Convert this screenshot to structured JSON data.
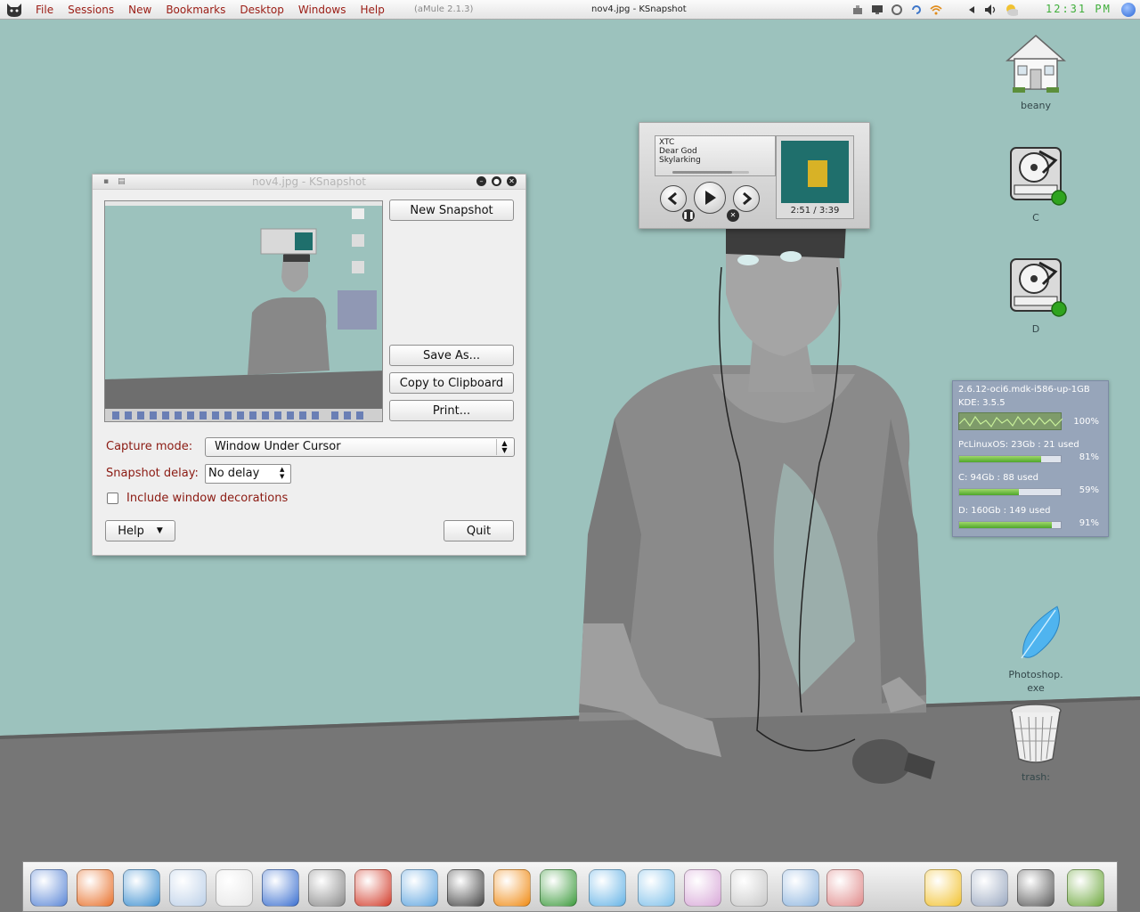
{
  "menubar": {
    "items": [
      "File",
      "Sessions",
      "New",
      "Bookmarks",
      "Desktop",
      "Windows",
      "Help"
    ],
    "app_title": "(aMule 2.1.3)",
    "window_title": "nov4.jpg - KSnapshot",
    "tray_icons": [
      "network-icon",
      "monitor-icon",
      "power-icon",
      "refresh-icon",
      "wifi-icon",
      "left-arrow-icon",
      "volume-icon",
      "weather-icon"
    ],
    "clock": "12:31 PM"
  },
  "desktop_icons": [
    {
      "label": "beany",
      "icon": "home-icon"
    },
    {
      "label": "C",
      "icon": "harddisk-icon"
    },
    {
      "label": "D",
      "icon": "harddisk-icon"
    },
    {
      "label": "Photoshop.\nexe",
      "icon": "feather-icon"
    },
    {
      "label": "trash:",
      "icon": "trash-icon"
    }
  ],
  "ksnapshot": {
    "title": "nov4.jpg - KSnapshot",
    "new_snapshot": "New Snapshot",
    "save_as": "Save As...",
    "copy_clipboard": "Copy to Clipboard",
    "print": "Print...",
    "capture_mode_label": "Capture mode:",
    "capture_mode_value": "Window Under Cursor",
    "snapshot_delay_label": "Snapshot delay:",
    "snapshot_delay_value": "No delay",
    "include_decorations_label": "Include window decorations",
    "include_decorations_checked": false,
    "help": "Help",
    "quit": "Quit"
  },
  "player": {
    "artist": "XTC",
    "track": "Dear God",
    "album": "Skylarking",
    "time": "2:51 / 3:39",
    "progress": 0.78
  },
  "sysmon": {
    "kernel": "2.6.12-oci6.mdk-i586-up-1GB",
    "kde": "KDE: 3.5.5",
    "cpu_pct": "100%",
    "cpu_value": 1.0,
    "disks": [
      {
        "label": "PcLinuxOS: 23Gb : 21 used",
        "pct": "81%",
        "value": 0.81
      },
      {
        "label": "C: 94Gb : 88 used",
        "pct": "59%",
        "value": 0.59
      },
      {
        "label": "D: 160Gb : 149 used",
        "pct": "91%",
        "value": 0.91
      }
    ]
  },
  "colors": {
    "menu_text": "#9b1c14",
    "clock": "#3fae3a",
    "wallpaper": "#9cc2bd",
    "bar_fill": "#4ea62a"
  },
  "dock": {
    "icons": [
      "finder-icon",
      "firefox-icon",
      "network-globe-icon",
      "rabbit-icon",
      "mail-icon",
      "notes-icon",
      "gimp-icon",
      "burner-icon",
      "dashboard-icon",
      "clapper-icon",
      "vlc-icon",
      "video-icon",
      "itunes-icon",
      "music-player-icon",
      "ipod-icon",
      "phone-icon",
      "scanner-icon",
      "camera-icon",
      "tux-icon",
      "settings-icon",
      "gauge-icon",
      "photo-icon"
    ]
  }
}
